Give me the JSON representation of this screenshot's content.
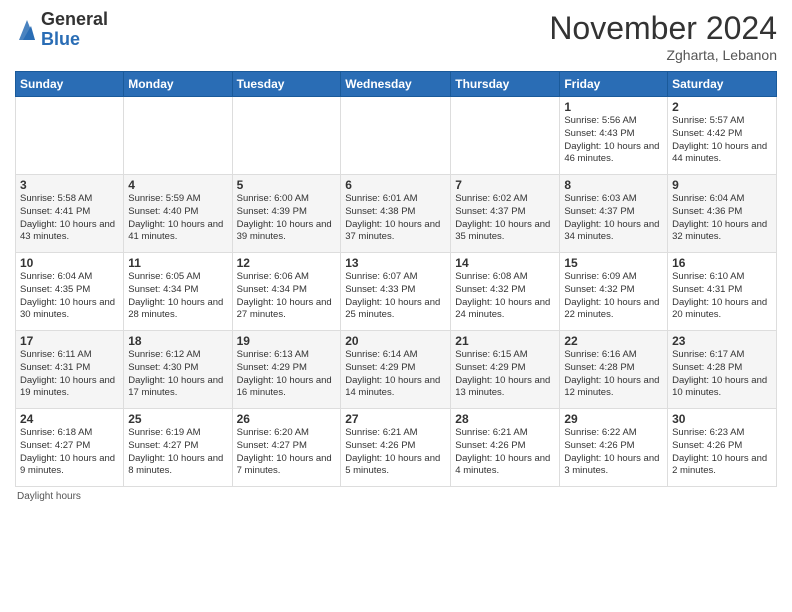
{
  "header": {
    "logo_general": "General",
    "logo_blue": "Blue",
    "title": "November 2024",
    "location": "Zgharta, Lebanon"
  },
  "weekdays": [
    "Sunday",
    "Monday",
    "Tuesday",
    "Wednesday",
    "Thursday",
    "Friday",
    "Saturday"
  ],
  "weeks": [
    [
      {
        "day": "",
        "info": ""
      },
      {
        "day": "",
        "info": ""
      },
      {
        "day": "",
        "info": ""
      },
      {
        "day": "",
        "info": ""
      },
      {
        "day": "",
        "info": ""
      },
      {
        "day": "1",
        "info": "Sunrise: 5:56 AM\nSunset: 4:43 PM\nDaylight: 10 hours and 46 minutes."
      },
      {
        "day": "2",
        "info": "Sunrise: 5:57 AM\nSunset: 4:42 PM\nDaylight: 10 hours and 44 minutes."
      }
    ],
    [
      {
        "day": "3",
        "info": "Sunrise: 5:58 AM\nSunset: 4:41 PM\nDaylight: 10 hours and 43 minutes."
      },
      {
        "day": "4",
        "info": "Sunrise: 5:59 AM\nSunset: 4:40 PM\nDaylight: 10 hours and 41 minutes."
      },
      {
        "day": "5",
        "info": "Sunrise: 6:00 AM\nSunset: 4:39 PM\nDaylight: 10 hours and 39 minutes."
      },
      {
        "day": "6",
        "info": "Sunrise: 6:01 AM\nSunset: 4:38 PM\nDaylight: 10 hours and 37 minutes."
      },
      {
        "day": "7",
        "info": "Sunrise: 6:02 AM\nSunset: 4:37 PM\nDaylight: 10 hours and 35 minutes."
      },
      {
        "day": "8",
        "info": "Sunrise: 6:03 AM\nSunset: 4:37 PM\nDaylight: 10 hours and 34 minutes."
      },
      {
        "day": "9",
        "info": "Sunrise: 6:04 AM\nSunset: 4:36 PM\nDaylight: 10 hours and 32 minutes."
      }
    ],
    [
      {
        "day": "10",
        "info": "Sunrise: 6:04 AM\nSunset: 4:35 PM\nDaylight: 10 hours and 30 minutes."
      },
      {
        "day": "11",
        "info": "Sunrise: 6:05 AM\nSunset: 4:34 PM\nDaylight: 10 hours and 28 minutes."
      },
      {
        "day": "12",
        "info": "Sunrise: 6:06 AM\nSunset: 4:34 PM\nDaylight: 10 hours and 27 minutes."
      },
      {
        "day": "13",
        "info": "Sunrise: 6:07 AM\nSunset: 4:33 PM\nDaylight: 10 hours and 25 minutes."
      },
      {
        "day": "14",
        "info": "Sunrise: 6:08 AM\nSunset: 4:32 PM\nDaylight: 10 hours and 24 minutes."
      },
      {
        "day": "15",
        "info": "Sunrise: 6:09 AM\nSunset: 4:32 PM\nDaylight: 10 hours and 22 minutes."
      },
      {
        "day": "16",
        "info": "Sunrise: 6:10 AM\nSunset: 4:31 PM\nDaylight: 10 hours and 20 minutes."
      }
    ],
    [
      {
        "day": "17",
        "info": "Sunrise: 6:11 AM\nSunset: 4:31 PM\nDaylight: 10 hours and 19 minutes."
      },
      {
        "day": "18",
        "info": "Sunrise: 6:12 AM\nSunset: 4:30 PM\nDaylight: 10 hours and 17 minutes."
      },
      {
        "day": "19",
        "info": "Sunrise: 6:13 AM\nSunset: 4:29 PM\nDaylight: 10 hours and 16 minutes."
      },
      {
        "day": "20",
        "info": "Sunrise: 6:14 AM\nSunset: 4:29 PM\nDaylight: 10 hours and 14 minutes."
      },
      {
        "day": "21",
        "info": "Sunrise: 6:15 AM\nSunset: 4:29 PM\nDaylight: 10 hours and 13 minutes."
      },
      {
        "day": "22",
        "info": "Sunrise: 6:16 AM\nSunset: 4:28 PM\nDaylight: 10 hours and 12 minutes."
      },
      {
        "day": "23",
        "info": "Sunrise: 6:17 AM\nSunset: 4:28 PM\nDaylight: 10 hours and 10 minutes."
      }
    ],
    [
      {
        "day": "24",
        "info": "Sunrise: 6:18 AM\nSunset: 4:27 PM\nDaylight: 10 hours and 9 minutes."
      },
      {
        "day": "25",
        "info": "Sunrise: 6:19 AM\nSunset: 4:27 PM\nDaylight: 10 hours and 8 minutes."
      },
      {
        "day": "26",
        "info": "Sunrise: 6:20 AM\nSunset: 4:27 PM\nDaylight: 10 hours and 7 minutes."
      },
      {
        "day": "27",
        "info": "Sunrise: 6:21 AM\nSunset: 4:26 PM\nDaylight: 10 hours and 5 minutes."
      },
      {
        "day": "28",
        "info": "Sunrise: 6:21 AM\nSunset: 4:26 PM\nDaylight: 10 hours and 4 minutes."
      },
      {
        "day": "29",
        "info": "Sunrise: 6:22 AM\nSunset: 4:26 PM\nDaylight: 10 hours and 3 minutes."
      },
      {
        "day": "30",
        "info": "Sunrise: 6:23 AM\nSunset: 4:26 PM\nDaylight: 10 hours and 2 minutes."
      }
    ]
  ],
  "footer": "Daylight hours"
}
